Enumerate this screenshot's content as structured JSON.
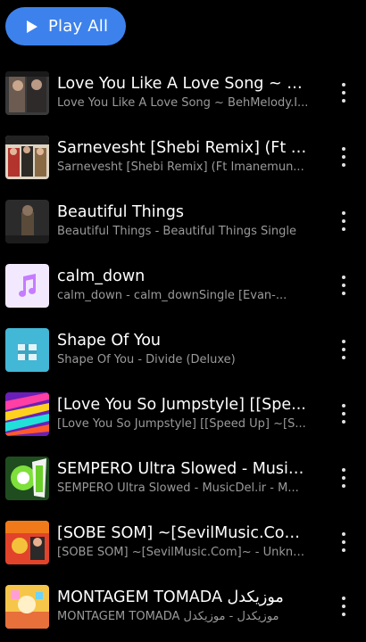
{
  "header": {
    "play_all_label": "Play All"
  },
  "tracks": [
    {
      "title": "Love You Like A Love Song ~ B...",
      "subtitle": "Love You Like A Love Song ~ BehMelody.I...",
      "art": "album-art-1"
    },
    {
      "title": "Sarnevesht [Shebi Remix] (Ft I...",
      "subtitle": "Sarnevesht [Shebi Remix] (Ft Imanemun...",
      "art": "album-art-2"
    },
    {
      "title": "Beautiful Things",
      "subtitle": "Beautiful Things - Beautiful Things Single",
      "art": "album-art-3"
    },
    {
      "title": "calm_down",
      "subtitle": "calm_down - calm_downSingle [Evan-...",
      "art": "music-note-icon"
    },
    {
      "title": "Shape Of You",
      "subtitle": "Shape Of You - Divide (Deluxe)",
      "art": "album-art-5"
    },
    {
      "title": "[Love You So Jumpstyle] [[Spe...",
      "subtitle": "[Love You So Jumpstyle] [[Speed Up] ~[S...",
      "art": "album-art-6"
    },
    {
      "title": "SEMPERO Ultra Slowed - Music...",
      "subtitle": "SEMPERO Ultra Slowed - MusicDel.ir - M...",
      "art": "album-art-7"
    },
    {
      "title": "[SOBE SOM] ~[SevilMusic.Com]~",
      "subtitle": "[SOBE SOM] ~[SevilMusic.Com]~ - Unkno...",
      "art": "album-art-8"
    },
    {
      "title": "MONTAGEM TOMADA موزیکدل",
      "subtitle": "MONTAGEM TOMADA موزیکدل - موزیکدل",
      "art": "album-art-9"
    }
  ],
  "colors": {
    "accent": "#3d82ec",
    "background": "#000000",
    "subtitle": "#9a9a9a"
  }
}
